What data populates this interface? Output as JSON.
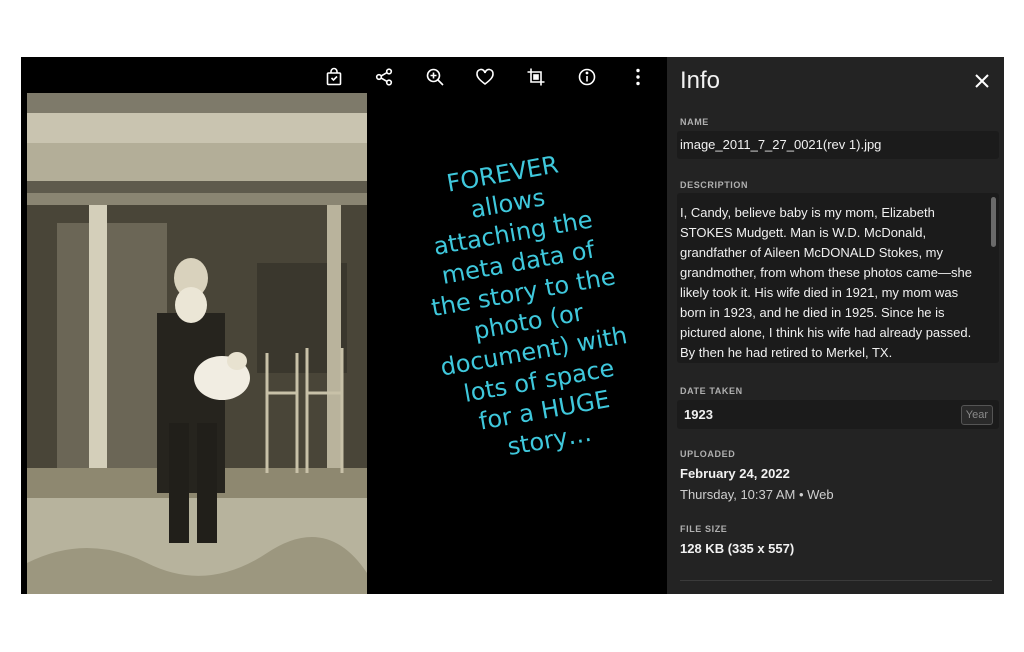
{
  "toolbar": {
    "icons": [
      "bag-icon",
      "share-icon",
      "zoom-in-icon",
      "heart-icon",
      "crop-icon",
      "info-icon",
      "more-icon"
    ]
  },
  "annotation": {
    "lines": [
      "FOREVER",
      "allows",
      "attaching the",
      "meta data of",
      "the story to the",
      "photo (or",
      "document) with",
      "lots of space",
      "for a HUGE",
      "story…"
    ],
    "color": "#3fc8dc"
  },
  "panel": {
    "title": "Info",
    "name_label": "NAME",
    "name_value": "image_2011_7_27_0021(rev 1).jpg",
    "description_label": "DESCRIPTION",
    "description": "I, Candy, believe baby is my mom, Elizabeth STOKES Mudgett. Man is W.D. McDonald, grandfather of Aileen McDONALD Stokes, my grandmother, from whom these photos came—she likely took it. His wife died in 1921, my mom was born in 1923, and he died in 1925. Since he is pictured alone, I think his wife had already passed. By then he had retired to Merkel, TX.",
    "date_label": "DATE TAKEN",
    "date_value": "1923",
    "date_unit": "Year",
    "uploaded_label": "UPLOADED",
    "uploaded_date": "February 24, 2022",
    "uploaded_detail": "Thursday, 10:37 AM • Web",
    "filesize_label": "FILE SIZE",
    "filesize_value": "128 KB (335 x 557)"
  }
}
